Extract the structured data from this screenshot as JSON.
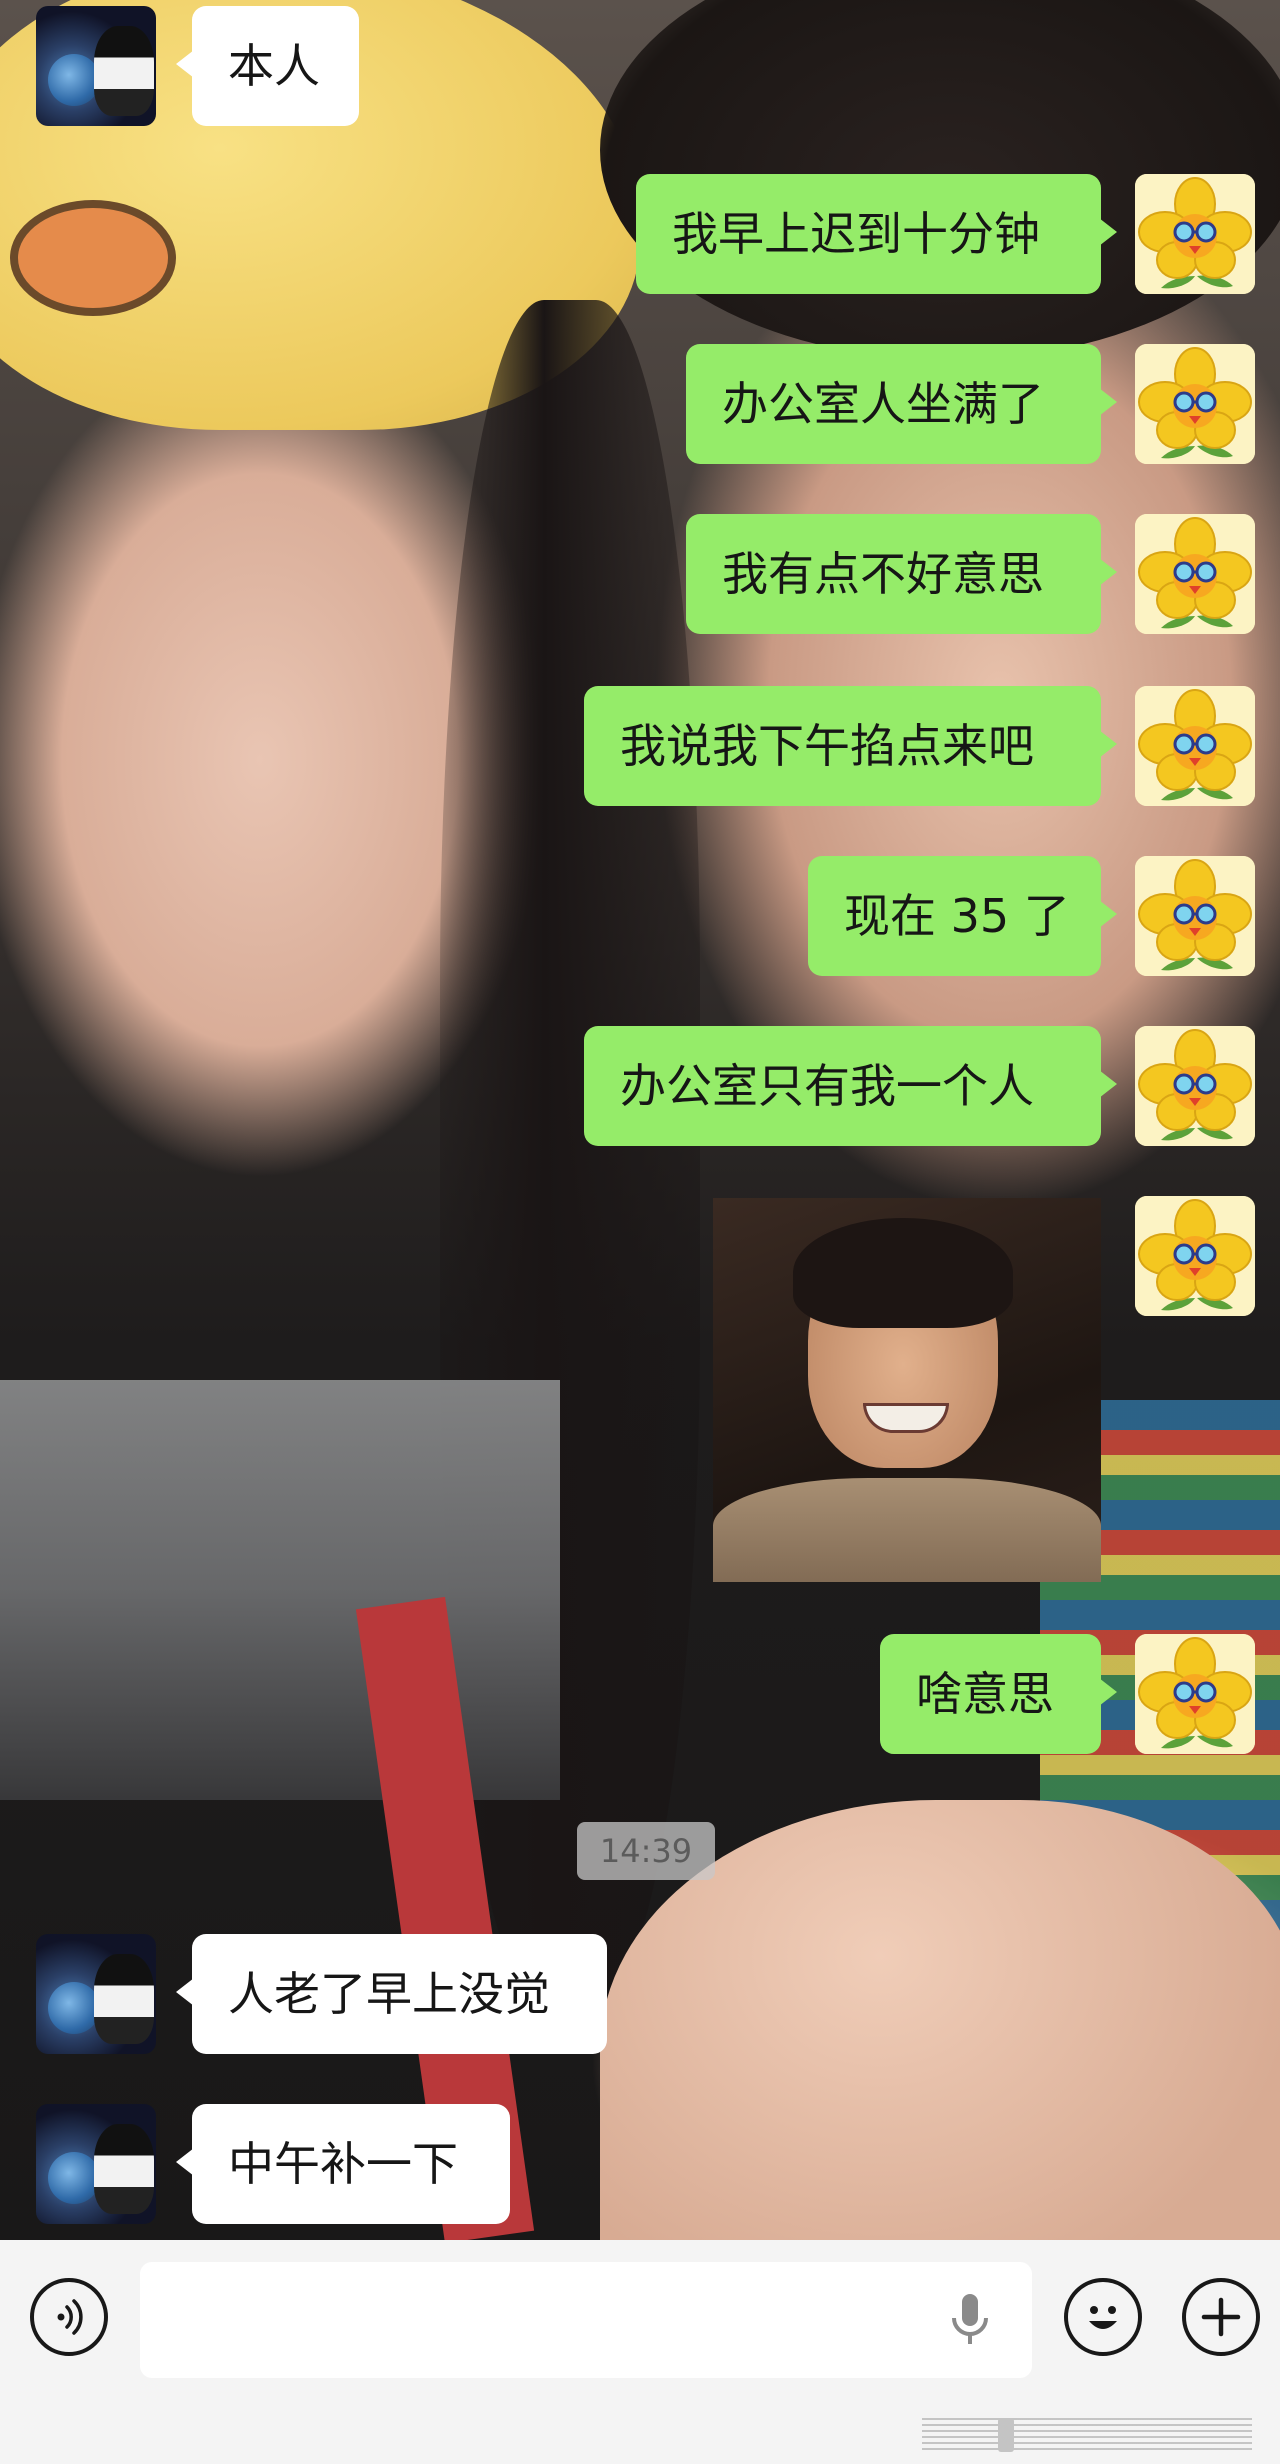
{
  "chat": {
    "messages": [
      {
        "from": "other",
        "text": "本人"
      },
      {
        "from": "self",
        "text": "我早上迟到十分钟"
      },
      {
        "from": "self",
        "text": "办公室人坐满了"
      },
      {
        "from": "self",
        "text": "我有点不好意思"
      },
      {
        "from": "self",
        "text": "我说我下午掐点来吧"
      },
      {
        "from": "self",
        "text": "现在 35 了"
      },
      {
        "from": "self",
        "text": "办公室只有我一个人"
      },
      {
        "from": "self",
        "type": "image"
      },
      {
        "from": "self",
        "text": "啥意思"
      },
      {
        "from": "other",
        "text": "人老了早上没觉"
      },
      {
        "from": "other",
        "text": "中午补一下"
      }
    ],
    "timestamp": "14:39"
  },
  "input_bar": {
    "text_value": "",
    "icons": [
      "voice-icon",
      "microphone-icon",
      "emoji-icon",
      "plus-icon"
    ]
  },
  "colors": {
    "outgoing_bubble": "#95ec69",
    "incoming_bubble": "#ffffff",
    "input_bar_bg": "#f4f4f4"
  }
}
